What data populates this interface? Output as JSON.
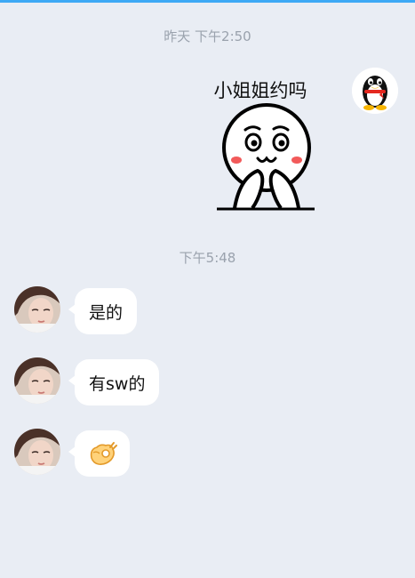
{
  "colors": {
    "background": "#e9edf4",
    "bubble": "#ffffff",
    "timestamp_text": "#9aa2ad",
    "top_accent": "#3da9f5"
  },
  "timestamps": {
    "first": "昨天 下午2:50",
    "second": "下午5:48"
  },
  "outgoing": {
    "sticker_caption": "小姐姐约吗",
    "sticker_icon": "blushing-face-sticker",
    "avatar_icon": "qq-penguin-icon"
  },
  "incoming": [
    {
      "text": "是的",
      "avatar_icon": "user-avatar-photo"
    },
    {
      "text": "有sw的",
      "avatar_icon": "user-avatar-photo"
    },
    {
      "text": "",
      "emoji_icon": "ok-hand-emoji",
      "avatar_icon": "user-avatar-photo"
    }
  ]
}
